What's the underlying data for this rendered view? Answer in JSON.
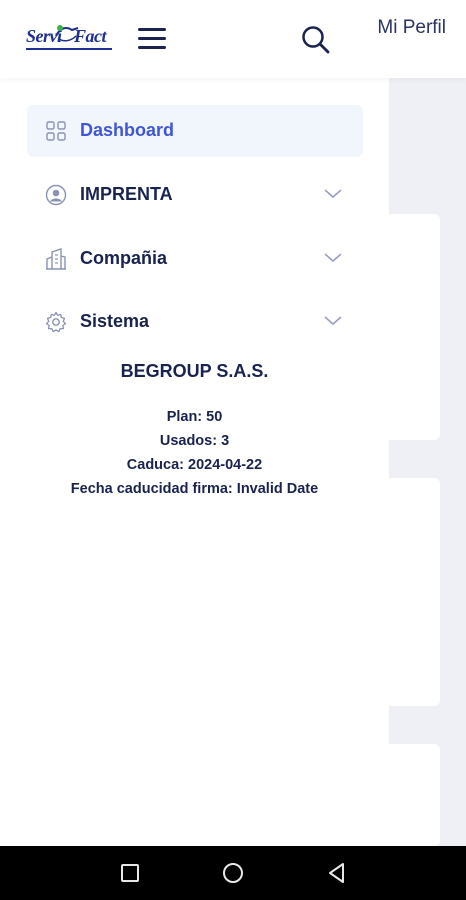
{
  "header": {
    "logo_left": "Servi",
    "logo_right": "Fact",
    "logo_icon": "handshake-logo",
    "menu_icon": "hamburger-icon",
    "search_icon": "search-icon",
    "profile_label": "Mi Perfil"
  },
  "sidebar": {
    "items": [
      {
        "label": "Dashboard",
        "icon": "grid-icon",
        "active": true,
        "expandable": false
      },
      {
        "label": "IMPRENTA",
        "icon": "user-circle-icon",
        "active": false,
        "expandable": true
      },
      {
        "label": "Compañia",
        "icon": "building-icon",
        "active": false,
        "expandable": true
      },
      {
        "label": "Sistema",
        "icon": "gear-icon",
        "active": false,
        "expandable": true
      }
    ],
    "company_name": "BEGROUP S.A.S.",
    "plan": "Plan: 50",
    "usados": "Usados: 3",
    "caduca": "Caduca: 2024-04-22",
    "firma": "Fecha caducidad firma: Invalid Date"
  },
  "system_nav": {
    "buttons": [
      "recent-apps-icon",
      "home-icon",
      "back-icon"
    ]
  },
  "colors": {
    "accent": "#3f57d6",
    "text": "#1a2350",
    "active_bg": "#f1f5fc",
    "page_bg": "#eef0f6"
  }
}
